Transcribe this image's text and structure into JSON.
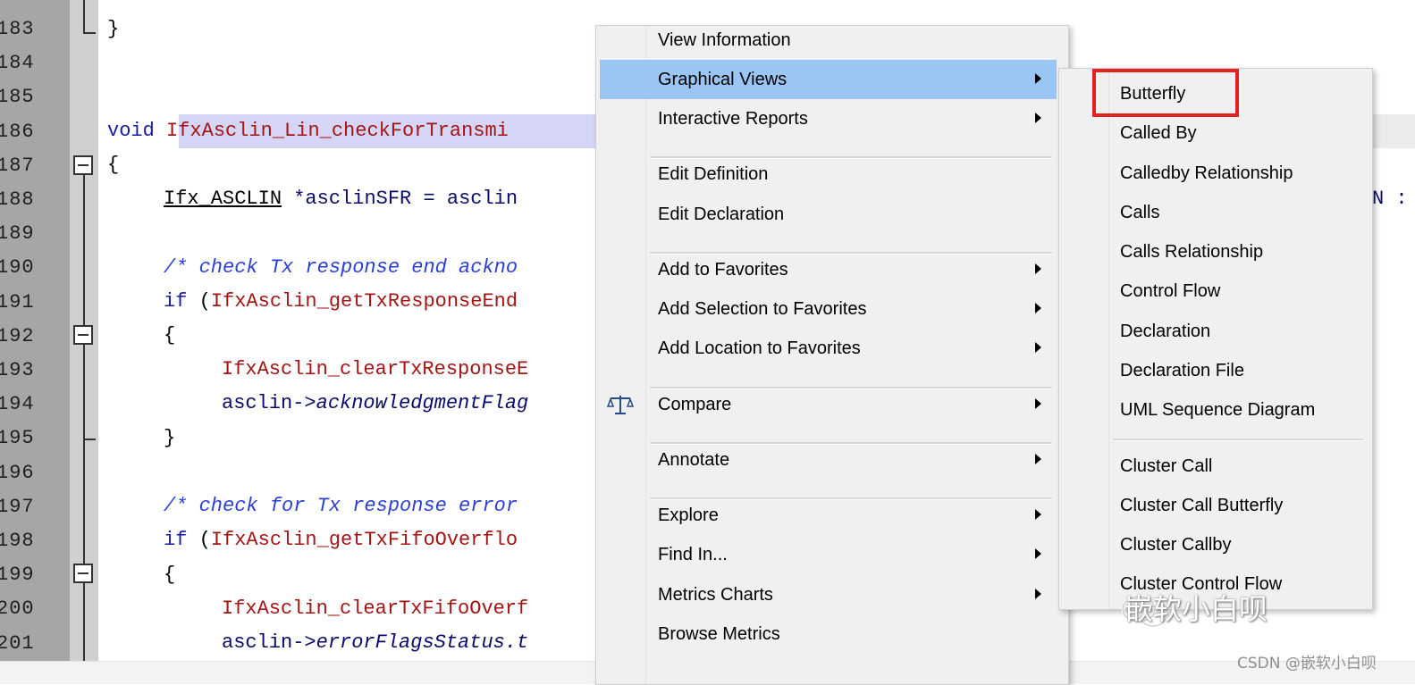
{
  "editor": {
    "line_numbers": [
      "183",
      "184",
      "185",
      "186",
      "187",
      "188",
      "189",
      "190",
      "191",
      "192",
      "193",
      "194",
      "195",
      "196",
      "197",
      "198",
      "199",
      "200",
      "201"
    ],
    "code": {
      "l183_brace": "}",
      "l186_kw": "void",
      "l186_fn": "IfxAsclin_Lin_checkForTransmi",
      "l187_brace": "{",
      "l188_type": "Ifx_ASCLIN",
      "l188_rest": " *asclinSFR = asclin",
      "l188_right": "N :",
      "l190_comment": "/* check Tx response end ackno",
      "l191_kw": "if",
      "l191_paren": " (",
      "l191_fn": "IfxAsclin_getTxResponseEnd",
      "l192_brace": "{",
      "l193_fn": "IfxAsclin_clearTxResponseE",
      "l194_ptr": "asclin->",
      "l194_member": "acknowledgmentFlag",
      "l195_brace": "}",
      "l197_comment": "/* check for Tx response error",
      "l198_kw": "if",
      "l198_paren": " (",
      "l198_fn": "IfxAsclin_getTxFifoOverflo",
      "l199_brace": "{",
      "l200_fn": "IfxAsclin_clearTxFifoOverf",
      "l201_ptr": "asclin->",
      "l201_member": "errorFlagsStatus.t"
    }
  },
  "context_menu": {
    "items": [
      {
        "label": "View Information",
        "has_submenu": false
      },
      {
        "label": "Graphical Views",
        "has_submenu": true,
        "active": true
      },
      {
        "label": "Interactive Reports",
        "has_submenu": true
      },
      {
        "label": "Edit Definition",
        "has_submenu": false
      },
      {
        "label": "Edit Declaration",
        "has_submenu": false
      },
      {
        "label": "Add to Favorites",
        "has_submenu": true
      },
      {
        "label": "Add Selection to Favorites",
        "has_submenu": true
      },
      {
        "label": "Add Location to Favorites",
        "has_submenu": true
      },
      {
        "label": "Compare",
        "has_submenu": true,
        "icon": "balance-scale-icon"
      },
      {
        "label": "Annotate",
        "has_submenu": true
      },
      {
        "label": "Explore",
        "has_submenu": true
      },
      {
        "label": "Find In...",
        "has_submenu": true
      },
      {
        "label": "Metrics Charts",
        "has_submenu": true
      },
      {
        "label": "Browse Metrics",
        "has_submenu": false
      }
    ],
    "highlight_color": "#9bc6f4"
  },
  "submenu": {
    "items": [
      {
        "label": "Butterfly",
        "highlighted_box": true
      },
      {
        "label": "Called By"
      },
      {
        "label": "Calledby Relationship"
      },
      {
        "label": "Calls"
      },
      {
        "label": "Calls Relationship"
      },
      {
        "label": "Control Flow"
      },
      {
        "label": "Declaration"
      },
      {
        "label": "Declaration File"
      },
      {
        "label": "UML Sequence Diagram"
      },
      {
        "label": "Cluster Call"
      },
      {
        "label": "Cluster Call Butterfly"
      },
      {
        "label": "Cluster Callby"
      },
      {
        "label": "Cluster Control Flow"
      }
    ],
    "box_color": "#e32121"
  },
  "watermark": {
    "text": "嵌软小白呗",
    "csdn": "CSDN @嵌软小白呗"
  }
}
